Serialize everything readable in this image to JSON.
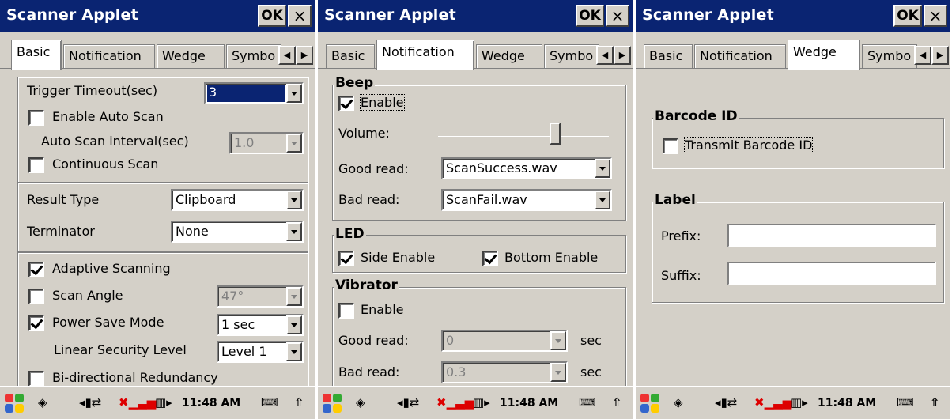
{
  "title": "Scanner Applet",
  "ok": "OK",
  "close": "×",
  "tabs": [
    "Basic",
    "Notification",
    "Wedge",
    "Symbo"
  ],
  "tab_scroll": {
    "left": "◀",
    "right": "▶"
  },
  "basic": {
    "trigger_timeout_label": "Trigger Timeout(sec)",
    "trigger_timeout_value": "3",
    "enable_auto_scan": "Enable Auto Scan",
    "auto_scan_interval_label": "Auto Scan interval(sec)",
    "auto_scan_interval_value": "1.0",
    "continuous_scan": "Continuous Scan",
    "result_type_label": "Result Type",
    "result_type_value": "Clipboard",
    "terminator_label": "Terminator",
    "terminator_value": "None",
    "adaptive_scanning": "Adaptive Scanning",
    "scan_angle": "Scan Angle",
    "scan_angle_value": "47°",
    "power_save_mode": "Power Save Mode",
    "power_save_value": "1 sec",
    "linear_security_label": "Linear Security Level",
    "linear_security_value": "Level 1",
    "bidirectional": "Bi-directional Redundancy"
  },
  "notification": {
    "beep": "Beep",
    "enable": "Enable",
    "volume": "Volume:",
    "volume_level": 0.7,
    "good_read": "Good read:",
    "good_read_value": "ScanSuccess.wav",
    "bad_read": "Bad read:",
    "bad_read_value": "ScanFail.wav",
    "led": "LED",
    "side_enable": "Side Enable",
    "bottom_enable": "Bottom Enable",
    "vibrator": "Vibrator",
    "vib_enable": "Enable",
    "vib_good_read": "Good read:",
    "vib_good_value": "0",
    "vib_bad_read": "Bad read:",
    "vib_bad_value": "0.3",
    "sec": "sec"
  },
  "wedge": {
    "barcode_id": "Barcode ID",
    "transmit_barcode_id": "Transmit Barcode ID",
    "label": "Label",
    "prefix": "Prefix:",
    "suffix": "Suffix:"
  },
  "taskbar": {
    "time": "11:48 AM"
  },
  "colors": {
    "title_bg": "#0a2472",
    "face": "#d4d0c8"
  }
}
